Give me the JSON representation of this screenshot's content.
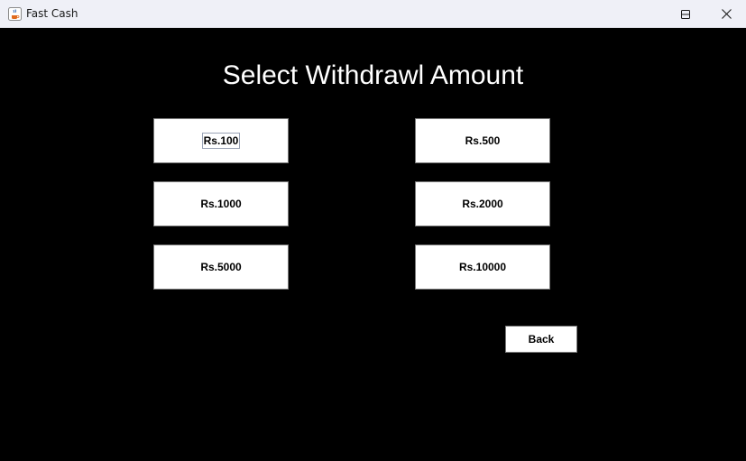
{
  "window": {
    "title": "Fast Cash",
    "app_icon": "java-cup-icon",
    "controls": [
      "minimize-icon",
      "maximize-icon",
      "close-icon"
    ]
  },
  "main": {
    "heading": "Select Withdrawl Amount",
    "amounts": [
      "Rs.100",
      "Rs.500",
      "Rs.1000",
      "Rs.2000",
      "Rs.5000",
      "Rs.10000"
    ],
    "back_label": "Back",
    "focused_button": "Rs.100"
  },
  "colors": {
    "background": "#000000",
    "button_bg": "#ffffff",
    "heading_text": "#ffffff",
    "titlebar_bg": "#eff0f7"
  }
}
